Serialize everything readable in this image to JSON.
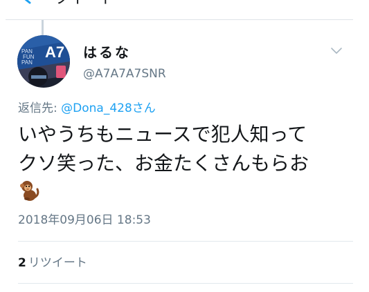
{
  "header": {
    "title": "ツイート",
    "back_icon": "chevron-left-icon"
  },
  "tweet": {
    "display_name": "はるな",
    "handle": "@A7A7A7SNR",
    "reply_prefix": "返信先: ",
    "reply_mention": "@Dona_428さん",
    "text": "いやうちもニュースで犯人知って\nクソ笑った、お金たくさんもらお",
    "emoji": "monkey-icon",
    "timestamp": "2018年09月06日 18:53",
    "retweet_count": "2",
    "retweet_label": "リツイート",
    "avatar_text": {
      "line1": "PAN",
      "line2": "FUN",
      "line3": "PAN",
      "big": "A7"
    }
  },
  "colors": {
    "accent": "#1da1f2",
    "secondary_text": "#657786",
    "primary_text": "#14171a",
    "divider": "#e1e8ed"
  }
}
